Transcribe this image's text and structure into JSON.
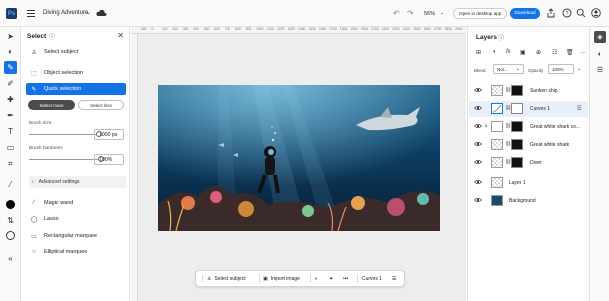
{
  "app": {
    "logo_text": "Ps",
    "document_title": "Diving Adventure"
  },
  "topbar": {
    "zoom": "56%",
    "open_desktop_label": "Open in desktop app",
    "download_label": "Download"
  },
  "tools": [
    "move-tool",
    "object-select-tool",
    "quick-selection-tool",
    "brush-tool",
    "clone-tool",
    "pen-tool",
    "type-tool",
    "eraser-tool",
    "crop-tool",
    "eyedropper-tool",
    "color-swatch",
    "swap-colors",
    "hide-toolbar"
  ],
  "select_panel": {
    "title": "Select",
    "items": {
      "select_subject": "Select subject",
      "object_selection": "Object selection",
      "quick_selection": "Quick selection",
      "magic_wand": "Magic wand",
      "lasso": "Lasso",
      "rect_marquee": "Rectangular marquee",
      "ellipse_marquee": "Elliptical marquee"
    },
    "mode_new": "Select more",
    "mode_less": "Select less",
    "brush_size_label": "Brush size",
    "brush_size_value": "1000 px",
    "brush_size_level": 0.97,
    "brush_hardness_label": "Brush hardness",
    "brush_hardness_value": "100%",
    "brush_hardness_level": 1.0,
    "advanced_label": "Advanced settings"
  },
  "ruler": {
    "ticks": [
      "300",
      "0",
      "100",
      "200",
      "300",
      "400",
      "500",
      "600",
      "700",
      "800",
      "900",
      "1000",
      "1100",
      "1200",
      "1300",
      "1400",
      "1500",
      "1600",
      "1700",
      "1800",
      "1900",
      "2000",
      "2100",
      "2200",
      "2300",
      "2400",
      "2500",
      "2600",
      "2700",
      "2800",
      "2900",
      "3000"
    ]
  },
  "bottom_bar": {
    "select_subject": "Select subject",
    "import_image": "Import image",
    "layer_name": "Curves 1"
  },
  "layers_panel": {
    "title": "Layers",
    "blend_label": "Blend",
    "blend_value": "Nor...",
    "opacity_label": "Opacity",
    "opacity_value": "100%",
    "layers": [
      {
        "name": "Sunken ship"
      },
      {
        "name": "Curves 1"
      },
      {
        "name": "Great white shark co..."
      },
      {
        "name": "Great white shark"
      },
      {
        "name": "Diver"
      },
      {
        "name": "Layer 1"
      },
      {
        "name": "Background"
      }
    ]
  },
  "colors": {
    "accent": "#1473e6",
    "ps_logo": "#1f3a64",
    "active_dark": "#4b4b4b"
  }
}
